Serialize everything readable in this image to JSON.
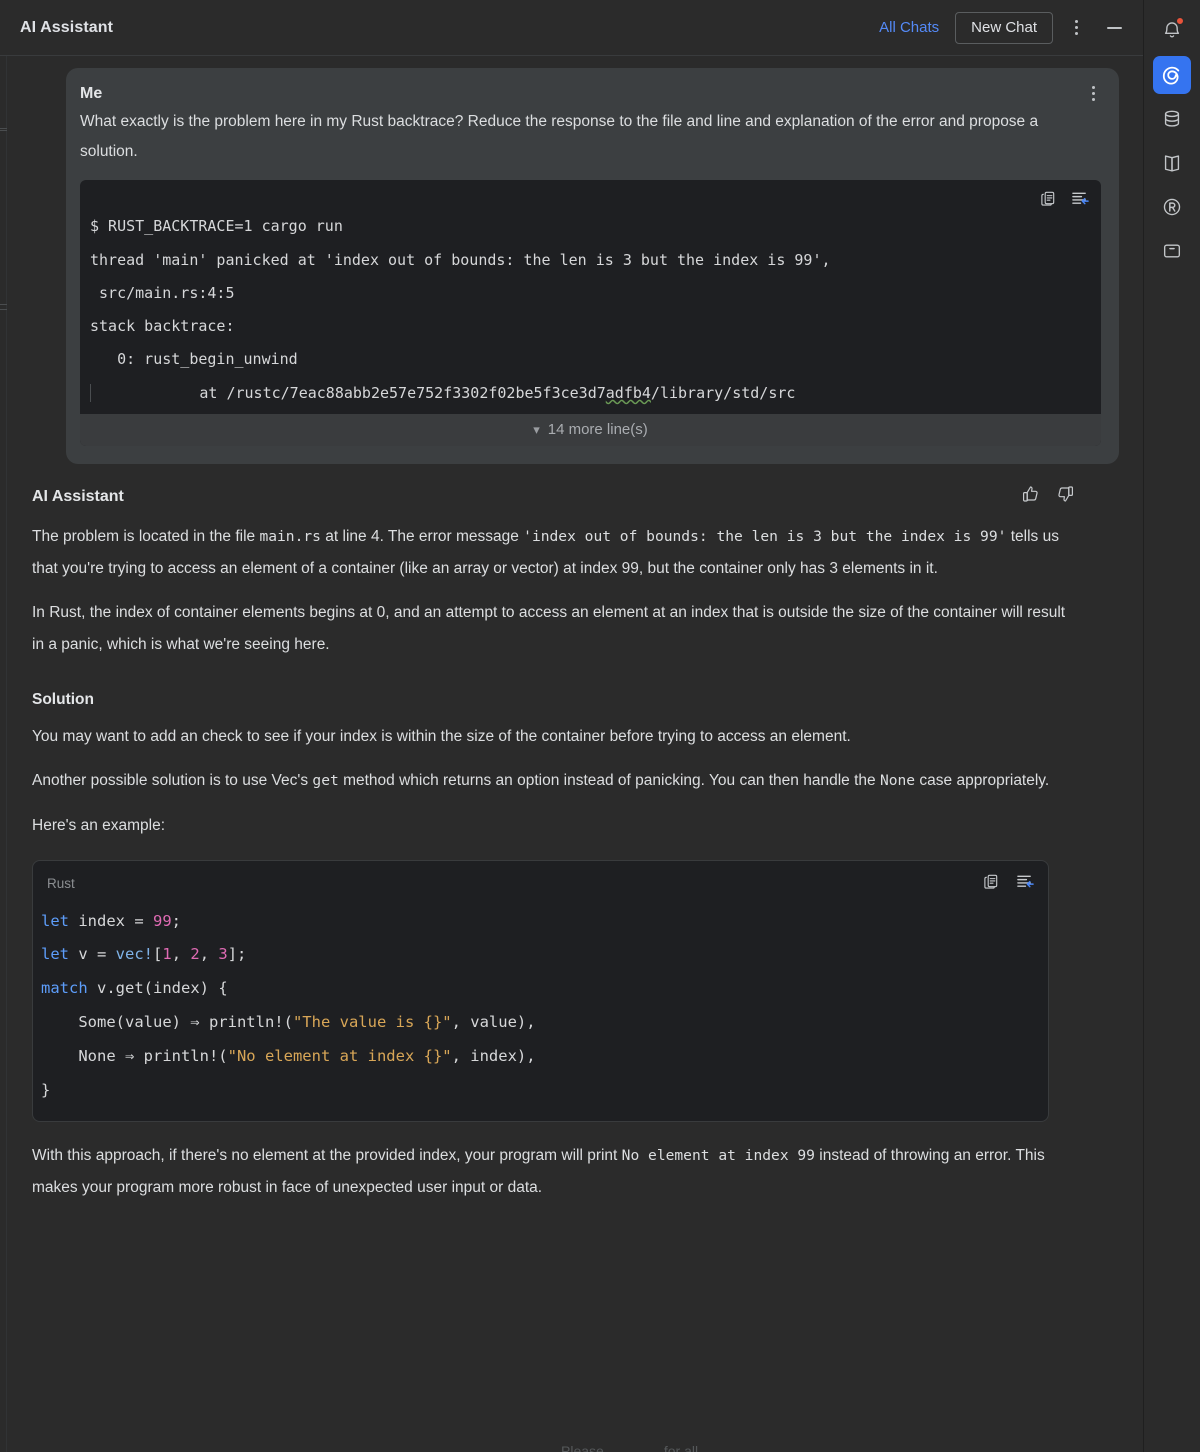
{
  "header": {
    "title": "AI Assistant",
    "all_chats_label": "All Chats",
    "new_chat_label": "New Chat",
    "more_icon": "kebab-menu-icon",
    "minimize_icon": "minimize-icon"
  },
  "rail": {
    "items": [
      {
        "icon": "bell-notification-icon",
        "active": false,
        "badge": true
      },
      {
        "icon": "ai-assistant-spiral-icon",
        "active": true,
        "badge": false
      },
      {
        "icon": "database-icon",
        "active": false,
        "badge": false
      },
      {
        "icon": "book-open-icon",
        "active": false,
        "badge": false
      },
      {
        "icon": "rust-crab-r-icon",
        "active": false,
        "badge": false
      },
      {
        "icon": "terminal-window-icon",
        "active": false,
        "badge": false
      }
    ]
  },
  "user_message": {
    "author": "Me",
    "text": "What exactly is the problem here in my Rust backtrace? Reduce the response to the file and line and explanation of the error and propose a solution.",
    "menu_icon": "kebab-menu-icon",
    "terminal": {
      "copy_icon": "copy-icon",
      "insert_icon": "insert-into-editor-icon",
      "lines": [
        "$ RUST_BACKTRACE=1 cargo run",
        "thread 'main' panicked at 'index out of bounds: the len is 3 but the index is 99',",
        " src/main.rs:4:5",
        "stack backtrace:",
        "   0: rust_begin_unwind"
      ],
      "at_line_prefix": "            at /rustc/7eac88abb2e57e752f3302f02be5f3ce3d7",
      "at_line_squiggle": "adfb4",
      "at_line_suffix": "/library/std/src",
      "collapse_label": "14 more line(s)",
      "collapse_icon": "chevron-down-icon"
    }
  },
  "assistant_message": {
    "author": "AI Assistant",
    "thumbs_up_icon": "thumbs-up-icon",
    "thumbs_down_icon": "thumbs-down-icon",
    "para1": {
      "s1": "The problem is located in the file ",
      "c1": "main.rs",
      "s2": " at line 4. The error message ",
      "c2": "'index out of bounds: the len is 3 but the index is 99'",
      "s3": " tells us that you're trying to access an element of a container (like an array or vector) at index 99, but the container only has 3 elements in it."
    },
    "para2": "In Rust, the index of container elements begins at 0, and an attempt to access an element at an index that is outside the size of the container will result in a panic, which is what we're seeing here.",
    "solution_heading": "Solution",
    "para3": "You may want to add an check to see if your index is within the size of the container before trying to access an element.",
    "para4": {
      "s1": "Another possible solution is to use Vec's ",
      "c1": "get",
      "s2": " method which returns an option instead of panicking. You can then handle the ",
      "c2": "None",
      "s3": " case appropriately."
    },
    "para5": "Here's an example:",
    "code": {
      "lang_label": "Rust",
      "copy_icon": "copy-icon",
      "insert_icon": "insert-into-editor-icon",
      "lines": [
        [
          {
            "t": "let",
            "c": "kw"
          },
          {
            "t": " index = ",
            "c": "plain"
          },
          {
            "t": "99",
            "c": "num"
          },
          {
            "t": ";",
            "c": "plain"
          }
        ],
        [
          {
            "t": "let",
            "c": "kw"
          },
          {
            "t": " v = ",
            "c": "plain"
          },
          {
            "t": "vec!",
            "c": "mac"
          },
          {
            "t": "[",
            "c": "plain"
          },
          {
            "t": "1",
            "c": "num"
          },
          {
            "t": ", ",
            "c": "plain"
          },
          {
            "t": "2",
            "c": "num"
          },
          {
            "t": ", ",
            "c": "plain"
          },
          {
            "t": "3",
            "c": "num"
          },
          {
            "t": "];",
            "c": "plain"
          }
        ],
        [
          {
            "t": "match",
            "c": "kw"
          },
          {
            "t": " v.get(index) {",
            "c": "plain"
          }
        ],
        [
          {
            "t": "    Some(value) ⇒ println!(",
            "c": "plain"
          },
          {
            "t": "\"The value is {}\"",
            "c": "str"
          },
          {
            "t": ", value),",
            "c": "plain"
          }
        ],
        [
          {
            "t": "    None ⇒ println!(",
            "c": "plain"
          },
          {
            "t": "\"No element at index {}\"",
            "c": "str"
          },
          {
            "t": ", index),",
            "c": "plain"
          }
        ],
        [
          {
            "t": "}",
            "c": "plain"
          }
        ]
      ]
    },
    "para6": {
      "s1": "With this approach, if there's no element at the provided index, your program will print ",
      "c1": "No element at index 99",
      "s2": " instead of throwing an error. This makes your program more robust in face of unexpected user input or data."
    }
  },
  "footer_cut": {
    "a": "Please",
    "b": "for all",
    "c": "."
  },
  "colors": {
    "app_bg": "#2b2b2b",
    "bubble_bg": "#3c3f41",
    "code_bg": "#1e1f22",
    "accent_blue": "#3574f0",
    "link_blue": "#548af7",
    "badge_red": "#e8533a",
    "keyword": "#5d9dfa",
    "number": "#e06bb4",
    "macro": "#7fb3e8",
    "string": "#d8a657"
  }
}
